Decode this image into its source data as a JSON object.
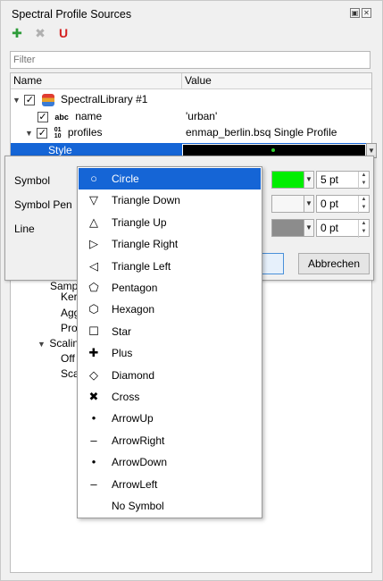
{
  "panel": {
    "title": "Spectral Profile Sources",
    "title_buttons": [
      "restore-icon",
      "close-icon"
    ],
    "toolbar": [
      {
        "name": "add-source-icon",
        "glyph": "✚",
        "color": "#2e9c3a"
      },
      {
        "name": "remove-source-icon",
        "glyph": "✖",
        "color": "#b0b0b0"
      },
      {
        "name": "magnet-icon",
        "glyph": "U",
        "color": "#d42020"
      }
    ]
  },
  "filter": {
    "placeholder": "Filter",
    "value": ""
  },
  "tree": {
    "headers": {
      "name": "Name",
      "value": "Value"
    },
    "rows": {
      "library": {
        "label": "SpectralLibrary #1"
      },
      "name": {
        "type_badge": "abc",
        "label": "name",
        "value": "'urban'"
      },
      "profiles": {
        "type_badge_top": "01",
        "type_badge_bottom": "10",
        "label": "profiles",
        "value": "enmap_berlin.bsq Single Profile"
      },
      "style": {
        "label": "Style"
      }
    },
    "behind_menu": {
      "r1": "Samp",
      "r2": "Ker",
      "r3": "Agg",
      "r4": "Pro",
      "r5": "Scalin",
      "r6": "Off",
      "r7": "Sca"
    }
  },
  "editor": {
    "symbol_label": "Symbol",
    "symbol_pen_label": "Symbol Pen",
    "line_label": "Line",
    "symbol_color": "#00ee00",
    "symbol_pen_color": "#f7f7f7",
    "line_color": "#8c8c8c",
    "symbol_size": "5 pt",
    "symbol_pen_width": "0 pt",
    "line_width": "0 pt",
    "cancel_label": "Abbrechen"
  },
  "symbol_menu": {
    "items": [
      {
        "label": "Circle",
        "glyph": "○",
        "icon": "circle-icon",
        "selected": true
      },
      {
        "label": "Triangle Down",
        "glyph": "▽",
        "icon": "triangle-down-icon"
      },
      {
        "label": "Triangle Up",
        "glyph": "△",
        "icon": "triangle-up-icon"
      },
      {
        "label": "Triangle Right",
        "glyph": "▷",
        "icon": "triangle-right-icon"
      },
      {
        "label": "Triangle Left",
        "glyph": "◁",
        "icon": "triangle-left-icon"
      },
      {
        "label": "Pentagon",
        "glyph": "⬠",
        "icon": "pentagon-icon"
      },
      {
        "label": "Hexagon",
        "glyph": "⬡",
        "icon": "hexagon-icon"
      },
      {
        "label": "Star",
        "glyph": "☐",
        "icon": "star-icon"
      },
      {
        "label": "Plus",
        "glyph": "✚",
        "icon": "plus-icon"
      },
      {
        "label": "Diamond",
        "glyph": "◇",
        "icon": "diamond-icon"
      },
      {
        "label": "Cross",
        "glyph": "✖",
        "icon": "cross-icon"
      },
      {
        "label": "ArrowUp",
        "glyph": "•",
        "icon": "arrow-up-icon"
      },
      {
        "label": "ArrowRight",
        "glyph": "–",
        "icon": "arrow-right-icon"
      },
      {
        "label": "ArrowDown",
        "glyph": "•",
        "icon": "arrow-down-icon"
      },
      {
        "label": "ArrowLeft",
        "glyph": "–",
        "icon": "arrow-left-icon"
      },
      {
        "label": "No Symbol",
        "glyph": "",
        "icon": "no-symbol-icon"
      }
    ]
  }
}
